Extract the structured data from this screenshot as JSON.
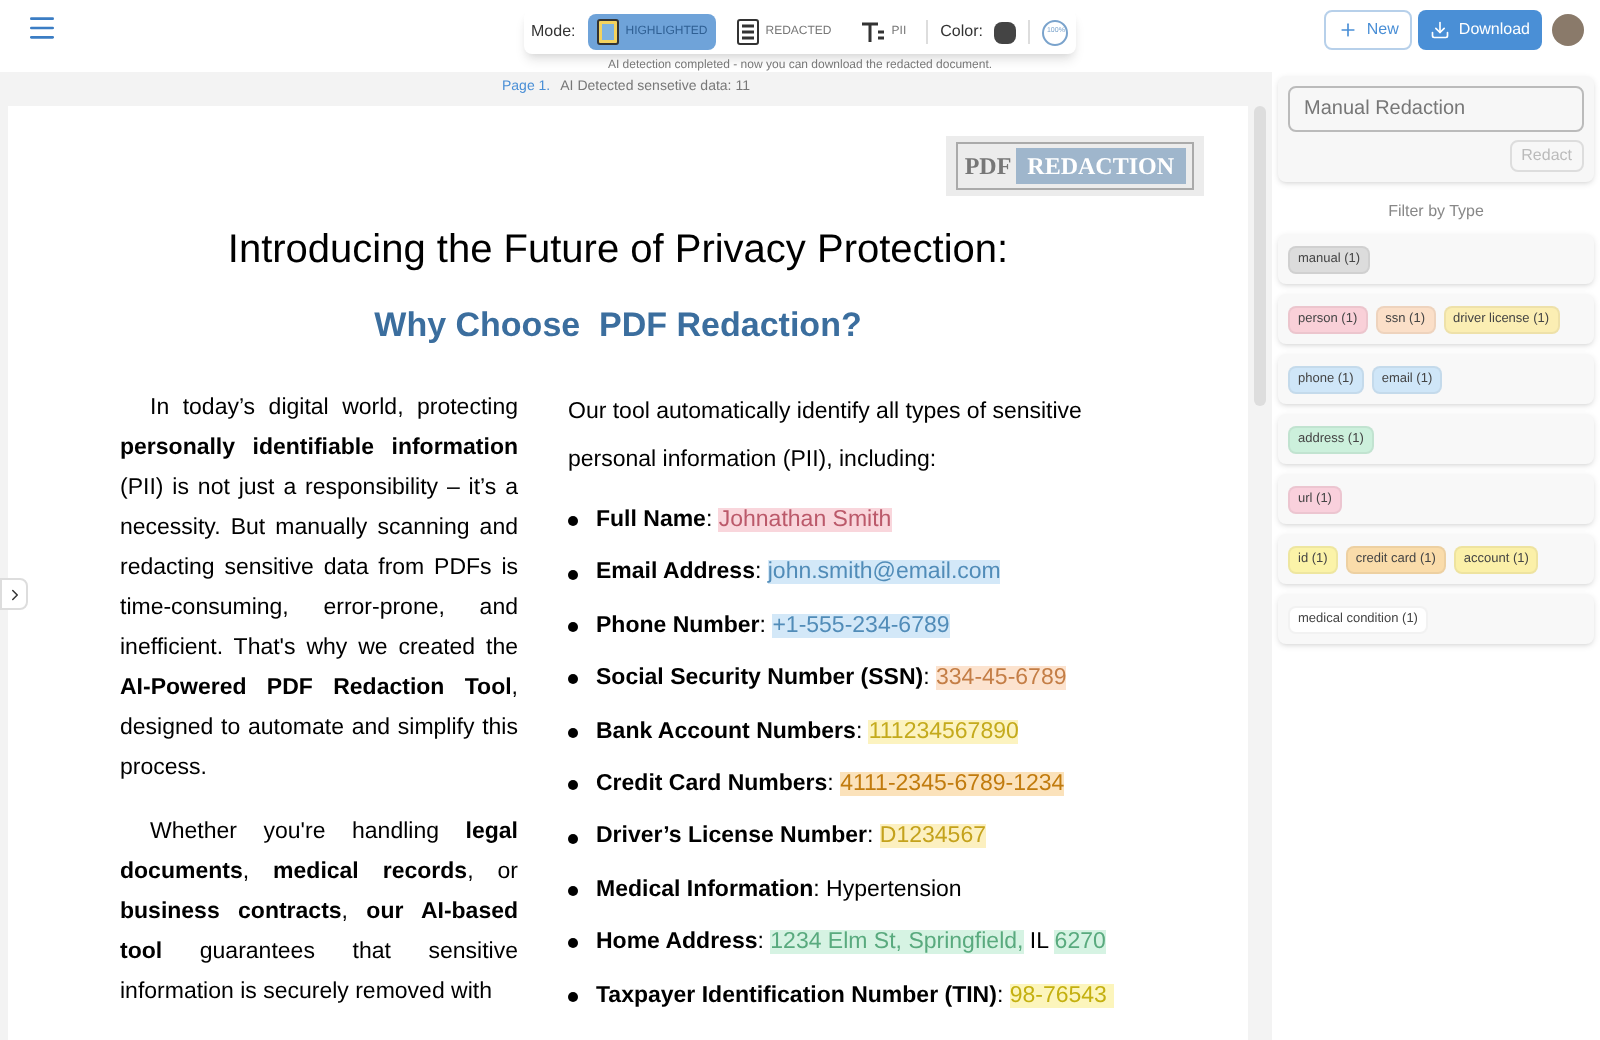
{
  "toolbar": {
    "mode_label": "Mode:",
    "modes": [
      {
        "label": "HIGHLIGHTED",
        "kind": "highlight",
        "selected": true
      },
      {
        "label": "REDACTED",
        "kind": "redact",
        "selected": false
      },
      {
        "label": "PII",
        "kind": "pii",
        "selected": false
      }
    ],
    "color_label": "Color:",
    "color": "#444444",
    "zoom": "100%",
    "status": "AI detection completed - now you can download the redacted document."
  },
  "actions": [
    {
      "label": "New",
      "kind": "outline"
    },
    {
      "label": "Download",
      "kind": "filled"
    }
  ],
  "page_info": {
    "page": "Page 1.",
    "detected": "AI Detected sensetive data: 11"
  },
  "document": {
    "logo": {
      "left": "PDF",
      "right": "REDACTION"
    },
    "title": "Introducing the Future of Privacy Protection:",
    "subtitle": "Why Choose  PDF Redaction?",
    "paragraphs": [
      "In today’s digital world, protecting **personally identifiable information** (PII) is not just a responsibility – it’s a necessity. But manually scanning and redacting sensitive data from PDFs is time-consuming, error-prone, and inefficient. That's why we created the **AI-Powered PDF Redaction Tool**, designed to automate and simplify this process.",
      "Whether you're handling **legal documents**, **medical records**, or **business contracts**, **our AI-based tool** guarantees that sensitive information is securely removed with"
    ],
    "intro": "Our tool automatically identify all types of sensitive personal information (PII), including:",
    "items": [
      {
        "label": "**Full Name**:",
        "segments": [
          {
            "text": "Johnathan Smith",
            "color": "#f9d6dc"
          }
        ]
      },
      {
        "label": "**Email Address**:",
        "segments": [
          {
            "text": "john.smith@email.com",
            "color": "#d3e8f8"
          }
        ]
      },
      {
        "label": "**Phone Number**:",
        "segments": [
          {
            "text": "+1-555-234-6789",
            "color": "#d3e8f8"
          }
        ]
      },
      {
        "label": "**Social Security Number (SSN)**:",
        "segments": [
          {
            "text": "334-45-6789",
            "color": "#fce3cf"
          }
        ]
      },
      {
        "label": "**Bank Account Numbers**:",
        "segments": [
          {
            "text": "111234567890",
            "color": "#fcf3c0"
          }
        ]
      },
      {
        "label": "**Credit Card Numbers**:",
        "segments": [
          {
            "text": "4111-2345-6789-1234",
            "color": "#fbe2bb"
          }
        ]
      },
      {
        "label": "**Driver’s License Number**:",
        "segments": [
          {
            "text": "D1234567",
            "color": "#fcf0c0"
          }
        ]
      },
      {
        "label": "**Medical Information**:",
        "segments": [
          {
            "text": "Hypertension"
          }
        ]
      },
      {
        "label": "**Home Address**:",
        "segments": [
          {
            "text": "1234 Elm St, Springfield,",
            "color": "#d6f3e3"
          },
          {
            "text": " IL "
          },
          {
            "text": "6270",
            "color": "#d6f3e3"
          }
        ]
      },
      {
        "label": "**Taxpayer Identification Number (TIN)**:",
        "segments": [
          {
            "text": "98-76543 ",
            "color": "#fcf5bc"
          }
        ]
      }
    ]
  },
  "sidebar": {
    "manual_placeholder": "Manual Redaction",
    "redact": {
      "label": "Redact",
      "disabled": true
    },
    "filter_title": "Filter by Type",
    "groups": [
      [
        {
          "label": "manual (1)",
          "color": "#dcdcdc"
        }
      ],
      [
        {
          "label": "person (1)",
          "color": "#f9d0d8"
        },
        {
          "label": "ssn (1)",
          "color": "#fbdfc8"
        },
        {
          "label": "driver license (1)",
          "color": "#fbeeb3"
        }
      ],
      [
        {
          "label": "phone (1)",
          "color": "#cfe6f8"
        },
        {
          "label": "email (1)",
          "color": "#cfe6f8"
        }
      ],
      [
        {
          "label": "address (1)",
          "color": "#ccf0dc"
        }
      ],
      [
        {
          "label": "url (1)",
          "color": "#f9d0dc"
        }
      ],
      [
        {
          "label": "id (1)",
          "color": "#fbf3a8"
        },
        {
          "label": "credit card (1)",
          "color": "#fadcaa"
        },
        {
          "label": "account (1)",
          "color": "#fbf0a8"
        }
      ],
      [
        {
          "label": "medical condition (1)",
          "color": "#ffffff"
        }
      ]
    ]
  }
}
